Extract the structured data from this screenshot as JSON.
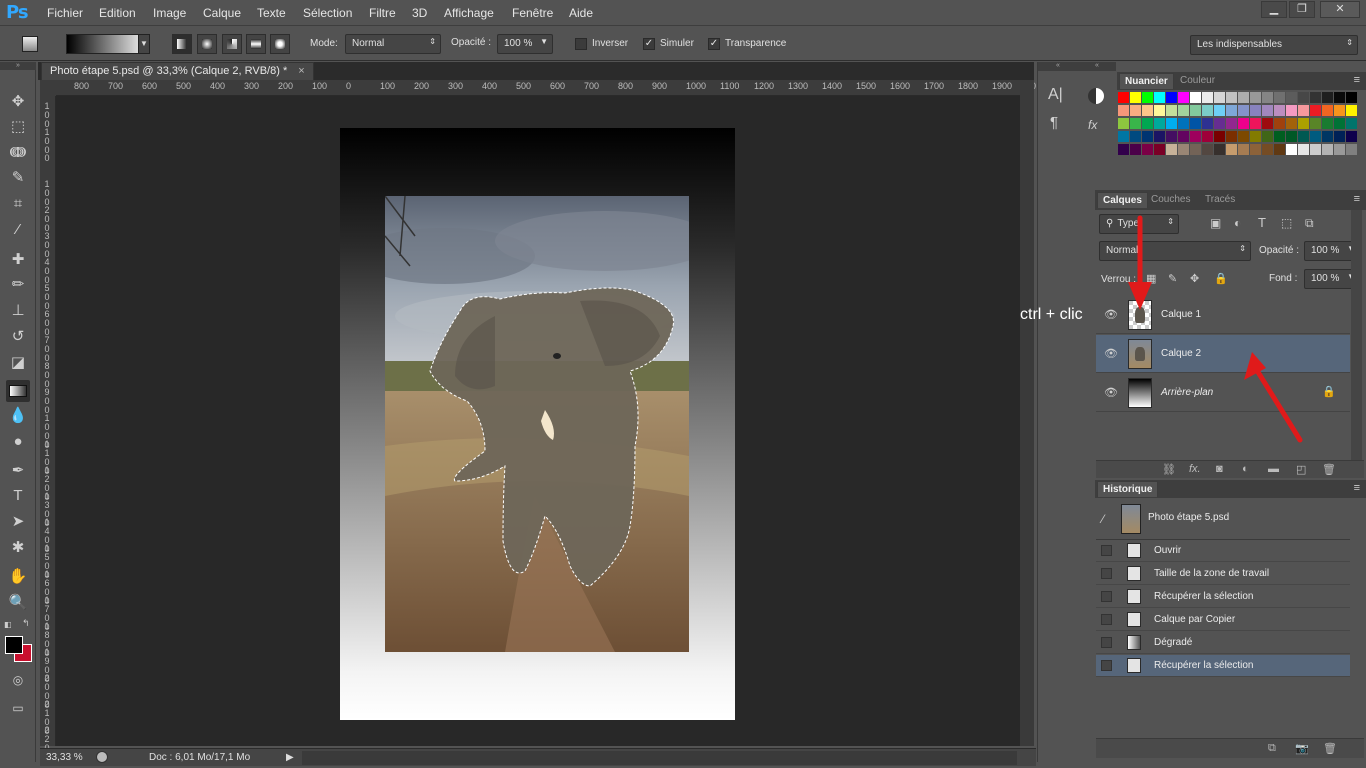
{
  "app": {
    "logo": "Ps"
  },
  "menu": [
    "Fichier",
    "Edition",
    "Image",
    "Calque",
    "Texte",
    "Sélection",
    "Filtre",
    "3D",
    "Affichage",
    "Fenêtre",
    "Aide"
  ],
  "window_controls": {
    "minimize": "▁",
    "restore": "❐",
    "close": "✕"
  },
  "options": {
    "mode_label": "Mode:",
    "mode_value": "Normal",
    "opacity_label": "Opacité :",
    "opacity_value": "100 %",
    "inverser": "Inverser",
    "simuler": "Simuler",
    "transparence": "Transparence",
    "workspace": "Les indispensables"
  },
  "document": {
    "tab_title": "Photo étape 5.psd @ 33,3% (Calque 2, RVB/8) *",
    "close": "×",
    "zoom": "33,33 %",
    "doc_info": "Doc : 6,01 Mo/17,1 Mo"
  },
  "ruler": {
    "h_ticks": [
      "800",
      "700",
      "600",
      "500",
      "400",
      "300",
      "200",
      "100",
      "0",
      "100",
      "200",
      "300",
      "400",
      "500",
      "600",
      "700",
      "800",
      "900",
      "1000",
      "1100",
      "1200",
      "1300",
      "1400",
      "1500",
      "1600",
      "1700",
      "1800",
      "1900",
      "20"
    ],
    "v_ticks": [
      "1 0 0",
      "1 0 0",
      "0",
      "1 0 0",
      "2 0 0",
      "3 0 0",
      "4 0 0",
      "5 0 0",
      "6 0 0",
      "7 0 0",
      "8 0 0",
      "9 0 0",
      "1 0 0 0",
      "1 1 0 0",
      "1 2 0 0",
      "1 3 0 0",
      "1 4 0 0",
      "1 5 0 0",
      "1 6 0 0",
      "1 7 0 0",
      "1 8 0 0",
      "1 9 0 0",
      "2 0 0 0",
      "2 1 0 0",
      "2 2 0 0"
    ]
  },
  "swatches": {
    "tab_active": "Nuancier",
    "tab_other": "Couleur",
    "rows": [
      [
        "#ff0000",
        "#ffff00",
        "#00ff00",
        "#00ffff",
        "#0000ff",
        "#ff00ff",
        "#ffffff",
        "#ebebeb",
        "#d6d6d6",
        "#c2c2c2",
        "#adadad",
        "#999999",
        "#858585",
        "#707070",
        "#5c5c5c",
        "#474747",
        "#333333",
        "#1f1f1f",
        "#0a0a0a",
        "#000000"
      ],
      [
        "#f7977a",
        "#f9ad81",
        "#fdc68a",
        "#fff79a",
        "#c4df9b",
        "#a3d39c",
        "#82ca9d",
        "#7bcdc8",
        "#6ecff6",
        "#7ea7d8",
        "#8493ca",
        "#8882be",
        "#a187be",
        "#bc8dbf",
        "#f49ac2",
        "#f6989d",
        "#ed1c24",
        "#f26522",
        "#f7941d",
        "#fff200"
      ],
      [
        "#8dc73f",
        "#39b54a",
        "#00a651",
        "#00a99d",
        "#00aeef",
        "#0072bc",
        "#0054a6",
        "#2e3192",
        "#662d91",
        "#92278f",
        "#ec008c",
        "#ed145b",
        "#9e0b0f",
        "#a0410d",
        "#a3620a",
        "#aba000",
        "#598527",
        "#197b30",
        "#007236",
        "#00746b"
      ],
      [
        "#0076a3",
        "#004a80",
        "#003471",
        "#1b1464",
        "#440e62",
        "#630460",
        "#9e005d",
        "#9e0039",
        "#790000",
        "#7b2e00",
        "#7d4900",
        "#827b00",
        "#406618",
        "#005e20",
        "#005826",
        "#005952",
        "#005b7f",
        "#003663",
        "#002157",
        "#0d004c"
      ],
      [
        "#32004b",
        "#4b0049",
        "#7b0046",
        "#7a0026",
        "#c7b299",
        "#998675",
        "#736357",
        "#534741",
        "#37302d",
        "#c69c6d",
        "#a67c52",
        "#8c6239",
        "#754c24",
        "#603913",
        "#ffffff",
        "#e6e6e6",
        "#cccccc",
        "#b3b3b3",
        "#999999",
        "#808080"
      ]
    ]
  },
  "layers": {
    "tabs": [
      "Calques",
      "Couches",
      "Tracés"
    ],
    "filter": "Type",
    "blend": "Normal",
    "opacity_label": "Opacité :",
    "opacity_value": "100 %",
    "lock_label": "Verrou :",
    "fill_label": "Fond :",
    "fill_value": "100 %",
    "items": [
      {
        "name": "Calque 1",
        "selected": false,
        "locked": false
      },
      {
        "name": "Calque 2",
        "selected": true,
        "locked": false
      },
      {
        "name": "Arrière-plan",
        "selected": false,
        "locked": true
      }
    ],
    "bottom_icons": [
      "link-icon",
      "fx-icon",
      "mask-icon",
      "adjustment-icon",
      "folder-icon",
      "new-layer-icon",
      "trash-icon"
    ]
  },
  "history": {
    "tab": "Historique",
    "snapshot": "Photo étape 5.psd",
    "items": [
      {
        "label": "Ouvrir",
        "selected": false
      },
      {
        "label": "Taille de la zone de travail",
        "selected": false
      },
      {
        "label": "Récupérer la sélection",
        "selected": false
      },
      {
        "label": "Calque par Copier",
        "selected": false
      },
      {
        "label": "Dégradé",
        "selected": false
      },
      {
        "label": "Récupérer la sélection",
        "selected": true
      }
    ]
  },
  "annotation": {
    "text": "ctrl + clic",
    "arrow_color": "#e01a1a"
  }
}
